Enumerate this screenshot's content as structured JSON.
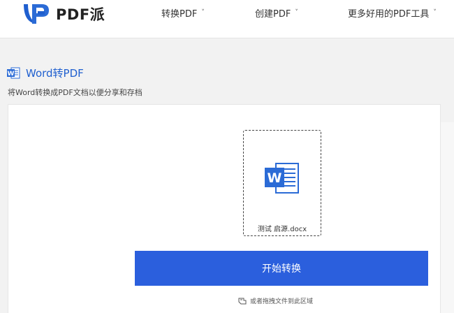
{
  "header": {
    "logo_text": "PDF派",
    "nav": [
      {
        "label": "转换PDF",
        "chevron": "˅"
      },
      {
        "label": "创建PDF",
        "chevron": "˅"
      },
      {
        "label": "更多好用的PDF工具",
        "chevron": "˅"
      }
    ]
  },
  "page": {
    "title": "Word转PDF",
    "subtitle": "将Word转换成PDF文档以便分享和存档"
  },
  "upload": {
    "file_name": "测试 启源.docx",
    "file_icon": "word-file-icon",
    "start_button": "开始转换",
    "drag_hint": "或者拖拽文件到此区域"
  },
  "colors": {
    "primary": "#2b5fdd",
    "title_blue": "#1f5fcf",
    "word_blue": "#2b6bd6"
  }
}
